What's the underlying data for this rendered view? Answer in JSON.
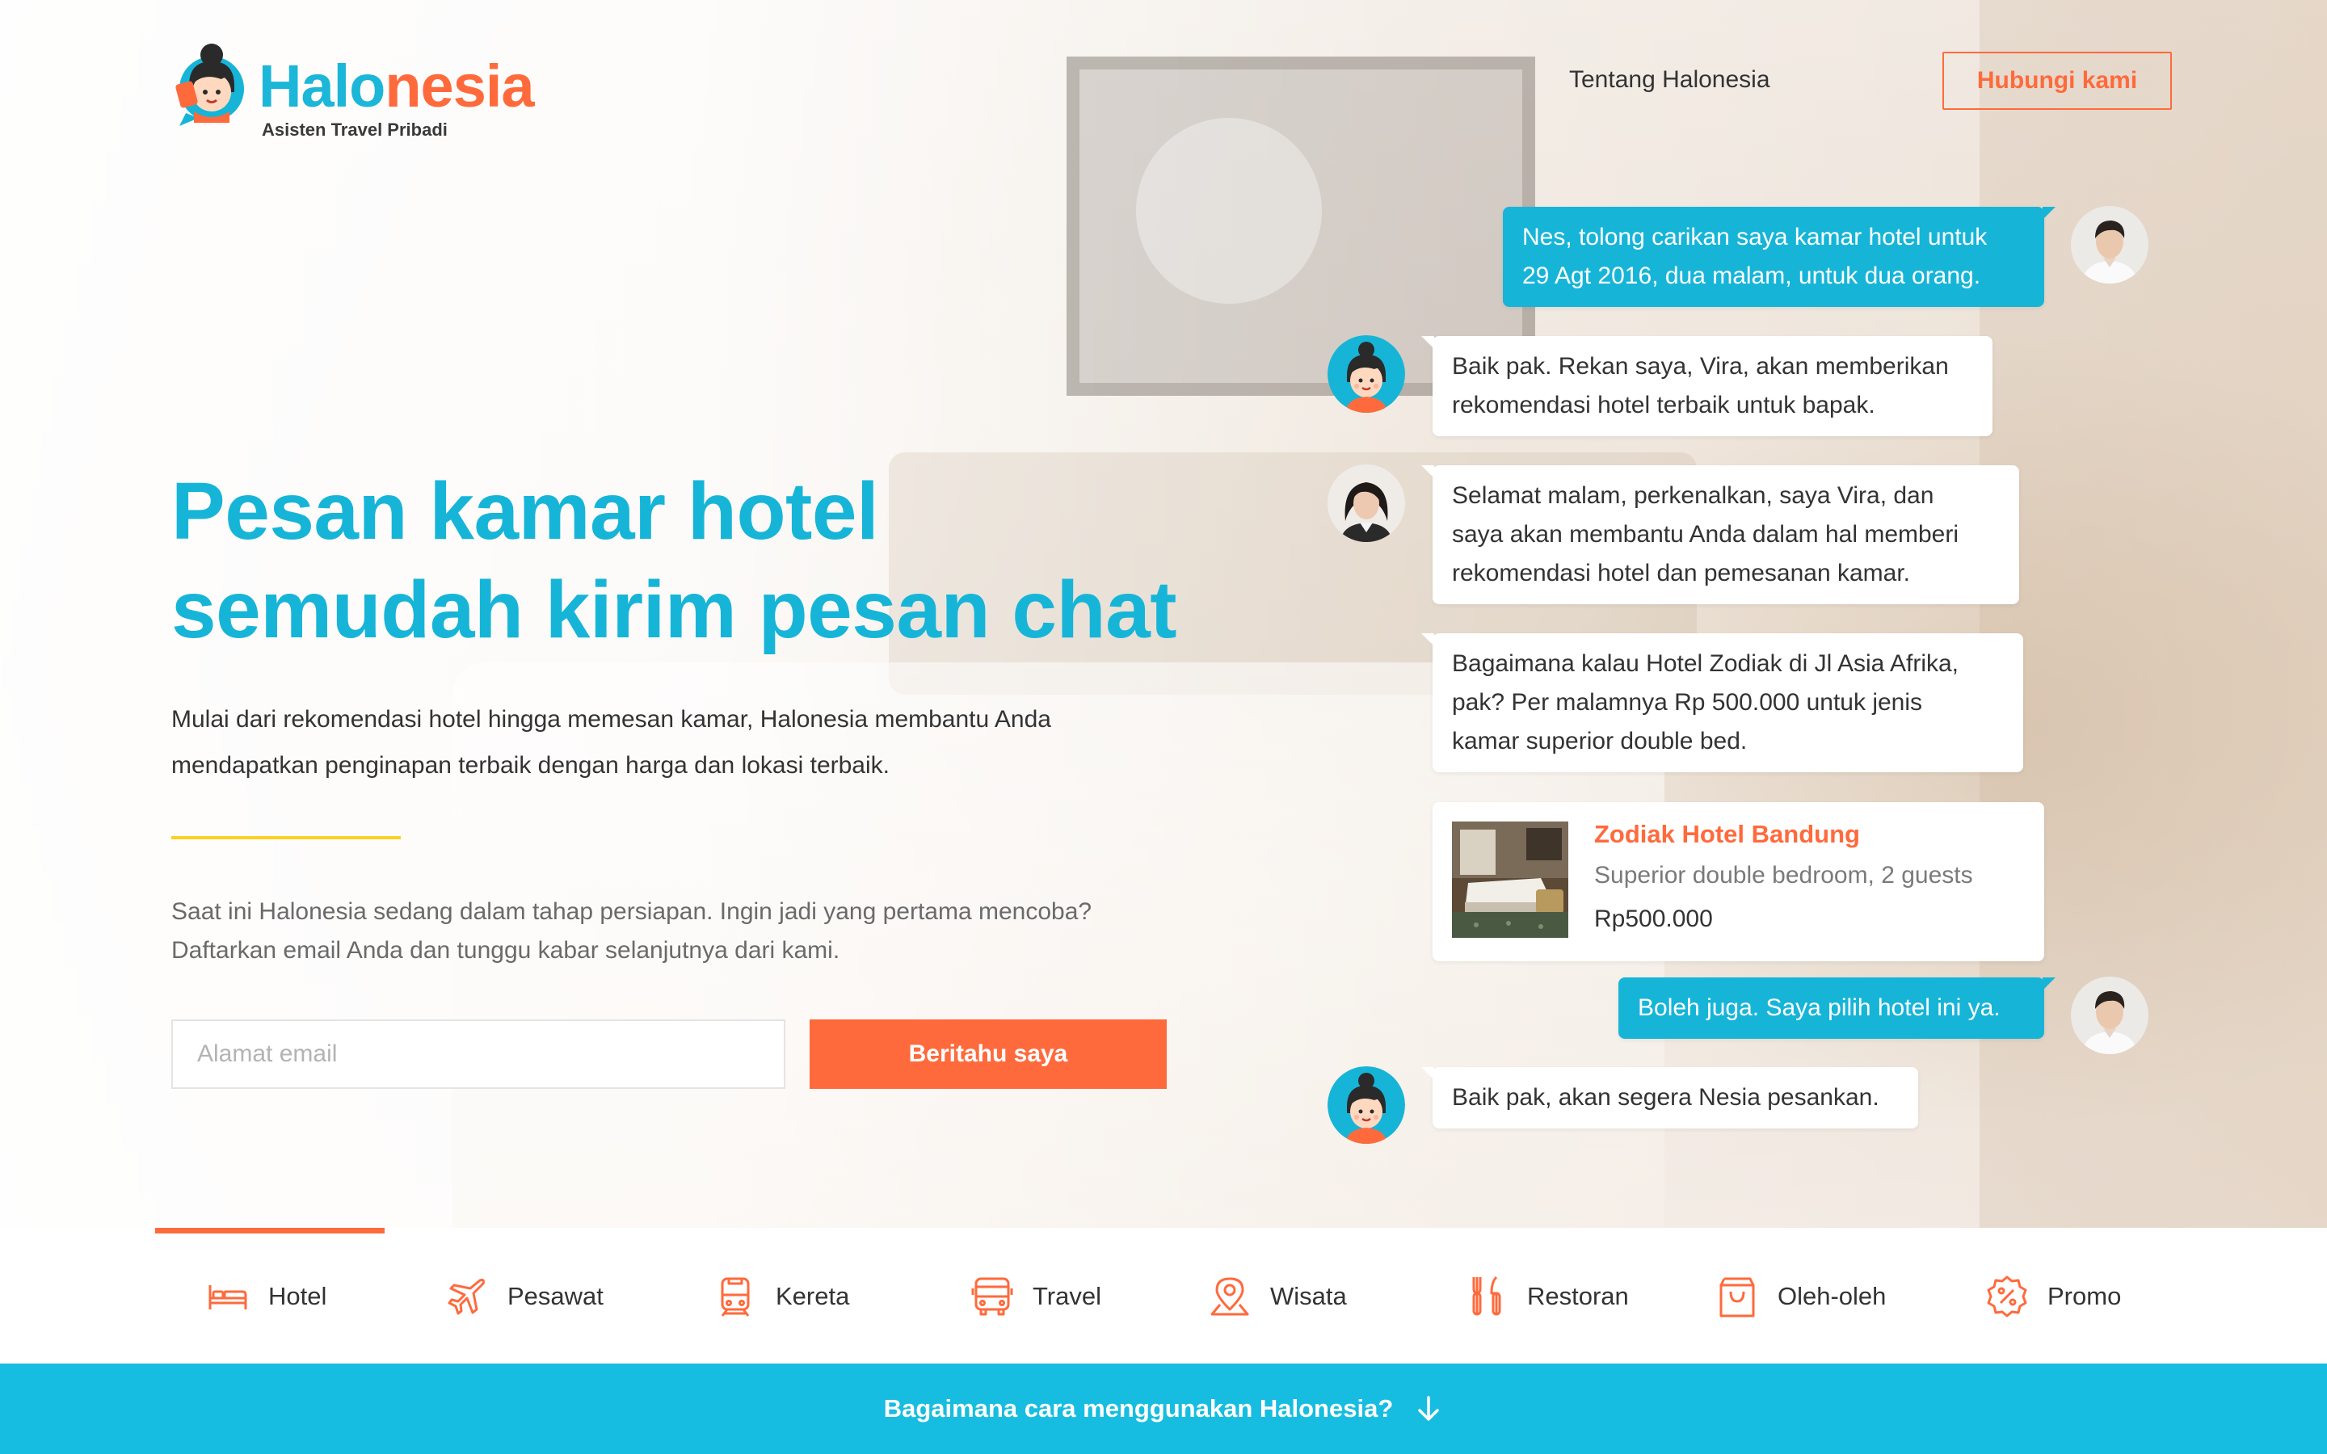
{
  "brand": {
    "name_part1": "Halo",
    "name_part2": "nesia",
    "tagline": "Asisten Travel Pribadi",
    "color_primary": "#16b5d8",
    "color_accent": "#ff6a3c"
  },
  "nav": {
    "about": "Tentang Halonesia",
    "contact": "Hubungi kami"
  },
  "hero": {
    "headline_line1": "Pesan kamar hotel",
    "headline_line2": "semudah kirim pesan chat",
    "subtext_line1": "Mulai dari rekomendasi hotel hingga memesan kamar, Halonesia membantu Anda",
    "subtext_line2": "mendapatkan penginapan terbaik dengan harga dan lokasi terbaik.",
    "notice_line1": "Saat ini Halonesia sedang dalam tahap persiapan. Ingin jadi yang pertama mencoba?",
    "notice_line2": "Daftarkan email Anda dan tunggu kabar selanjutnya dari kami.",
    "email_placeholder": "Alamat email",
    "notify_button": "Beritahu saya"
  },
  "chat": {
    "messages": [
      {
        "from": "user",
        "lines": [
          "Nes, tolong carikan saya kamar hotel untuk",
          "29 Agt 2016, dua malam, untuk dua orang."
        ]
      },
      {
        "from": "assistant",
        "lines": [
          "Baik pak. Rekan saya, Vira, akan memberikan",
          "rekomendasi hotel terbaik untuk bapak."
        ]
      },
      {
        "from": "agent",
        "lines": [
          "Selamat malam, perkenalkan, saya Vira, dan",
          "saya akan membantu Anda dalam hal memberi",
          "rekomendasi hotel dan pemesanan kamar."
        ]
      },
      {
        "from": "agent",
        "lines": [
          "Bagaimana kalau Hotel Zodiak di Jl Asia Afrika,",
          "pak? Per malamnya Rp 500.000 untuk jenis",
          "kamar superior double bed."
        ]
      },
      {
        "from": "user",
        "lines": [
          "Boleh juga. Saya pilih hotel ini ya."
        ]
      },
      {
        "from": "assistant",
        "lines": [
          "Baik pak, akan segera Nesia pesankan."
        ]
      }
    ],
    "hotel_card": {
      "name": "Zodiak Hotel Bandung",
      "room": "Superior double bedroom, 2 guests",
      "price": "Rp500.000"
    }
  },
  "categories": {
    "active": "Hotel",
    "items": [
      {
        "label": "Hotel",
        "icon": "bed-icon"
      },
      {
        "label": "Pesawat",
        "icon": "plane-icon"
      },
      {
        "label": "Kereta",
        "icon": "train-icon"
      },
      {
        "label": "Travel",
        "icon": "bus-icon"
      },
      {
        "label": "Wisata",
        "icon": "map-pin-icon"
      },
      {
        "label": "Restoran",
        "icon": "cutlery-icon"
      },
      {
        "label": "Oleh-oleh",
        "icon": "shopping-bag-icon"
      },
      {
        "label": "Promo",
        "icon": "discount-badge-icon"
      }
    ]
  },
  "footer": {
    "how_to": "Bagaimana cara menggunakan Halonesia?",
    "icon": "arrow-down-icon"
  }
}
